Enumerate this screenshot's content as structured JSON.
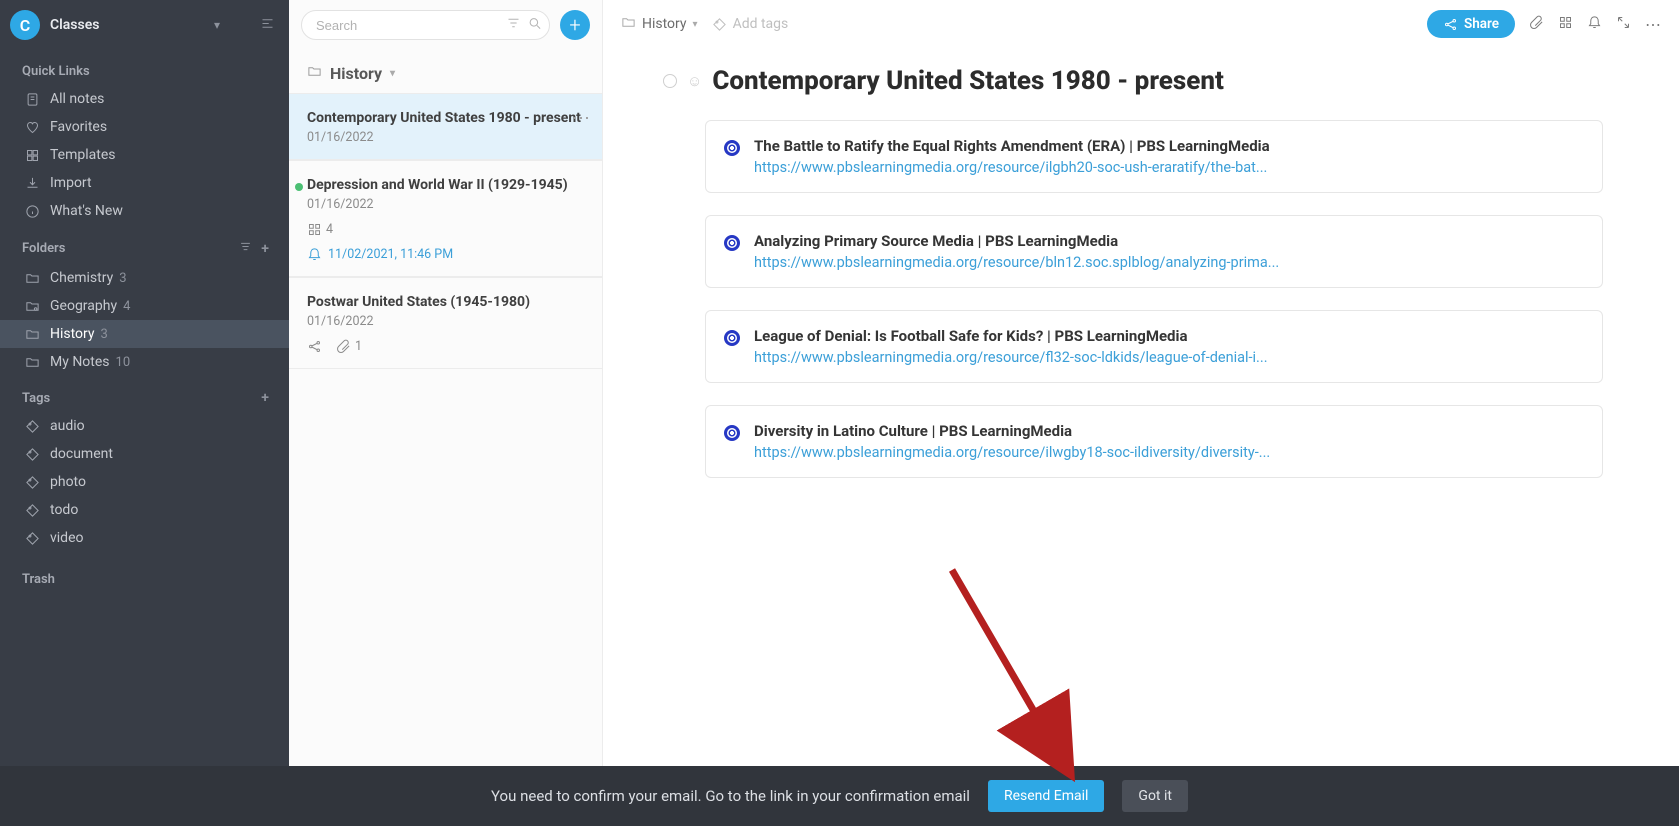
{
  "workspace": {
    "avatar_letter": "C",
    "name": "Classes"
  },
  "sidebar": {
    "quick_links_title": "Quick Links",
    "quick_links": [
      {
        "label": "All notes"
      },
      {
        "label": "Favorites"
      },
      {
        "label": "Templates"
      },
      {
        "label": "Import"
      },
      {
        "label": "What's New"
      }
    ],
    "folders_title": "Folders",
    "folders": [
      {
        "label": "Chemistry",
        "count": "3"
      },
      {
        "label": "Geography",
        "count": "4"
      },
      {
        "label": "History",
        "count": "3"
      },
      {
        "label": "My Notes",
        "count": "10"
      }
    ],
    "tags_title": "Tags",
    "tags": [
      {
        "label": "audio"
      },
      {
        "label": "document"
      },
      {
        "label": "photo"
      },
      {
        "label": "todo"
      },
      {
        "label": "video"
      }
    ],
    "trash_label": "Trash"
  },
  "search": {
    "placeholder": "Search"
  },
  "list": {
    "breadcrumb": "History",
    "items": [
      {
        "title": "Contemporary United States 1980 - present",
        "date": "01/16/2022"
      },
      {
        "title": "Depression and World War II (1929-1945)",
        "date": "01/16/2022",
        "task_count": "4",
        "reminder": "11/02/2021, 11:46 PM",
        "dot": "green"
      },
      {
        "title": "Postwar United States (1945-1980)",
        "date": "01/16/2022",
        "share_count": "",
        "attach_count": "1"
      }
    ]
  },
  "main": {
    "breadcrumb": "History",
    "add_tags": "Add tags",
    "share_label": "Share",
    "title": "Contemporary United States 1980 - present",
    "links": [
      {
        "title": "The Battle to Ratify the Equal Rights Amendment (ERA) | PBS LearningMedia",
        "url": "https://www.pbslearningmedia.org/resource/ilgbh20-soc-ush-eraratify/the-bat..."
      },
      {
        "title": "Analyzing Primary Source Media | PBS LearningMedia",
        "url": "https://www.pbslearningmedia.org/resource/bln12.soc.splblog/analyzing-prima..."
      },
      {
        "title": "League of Denial: Is Football Safe for Kids? | PBS LearningMedia",
        "url": "https://www.pbslearningmedia.org/resource/fl32-soc-ldkids/league-of-denial-i..."
      },
      {
        "title": "Diversity in Latino Culture | PBS LearningMedia",
        "url": "https://www.pbslearningmedia.org/resource/ilwgby18-soc-ildiversity/diversity-..."
      }
    ]
  },
  "banner": {
    "message": "You need to confirm your email. Go to the link in your confirmation email",
    "resend_label": "Resend Email",
    "gotit_label": "Got it"
  }
}
